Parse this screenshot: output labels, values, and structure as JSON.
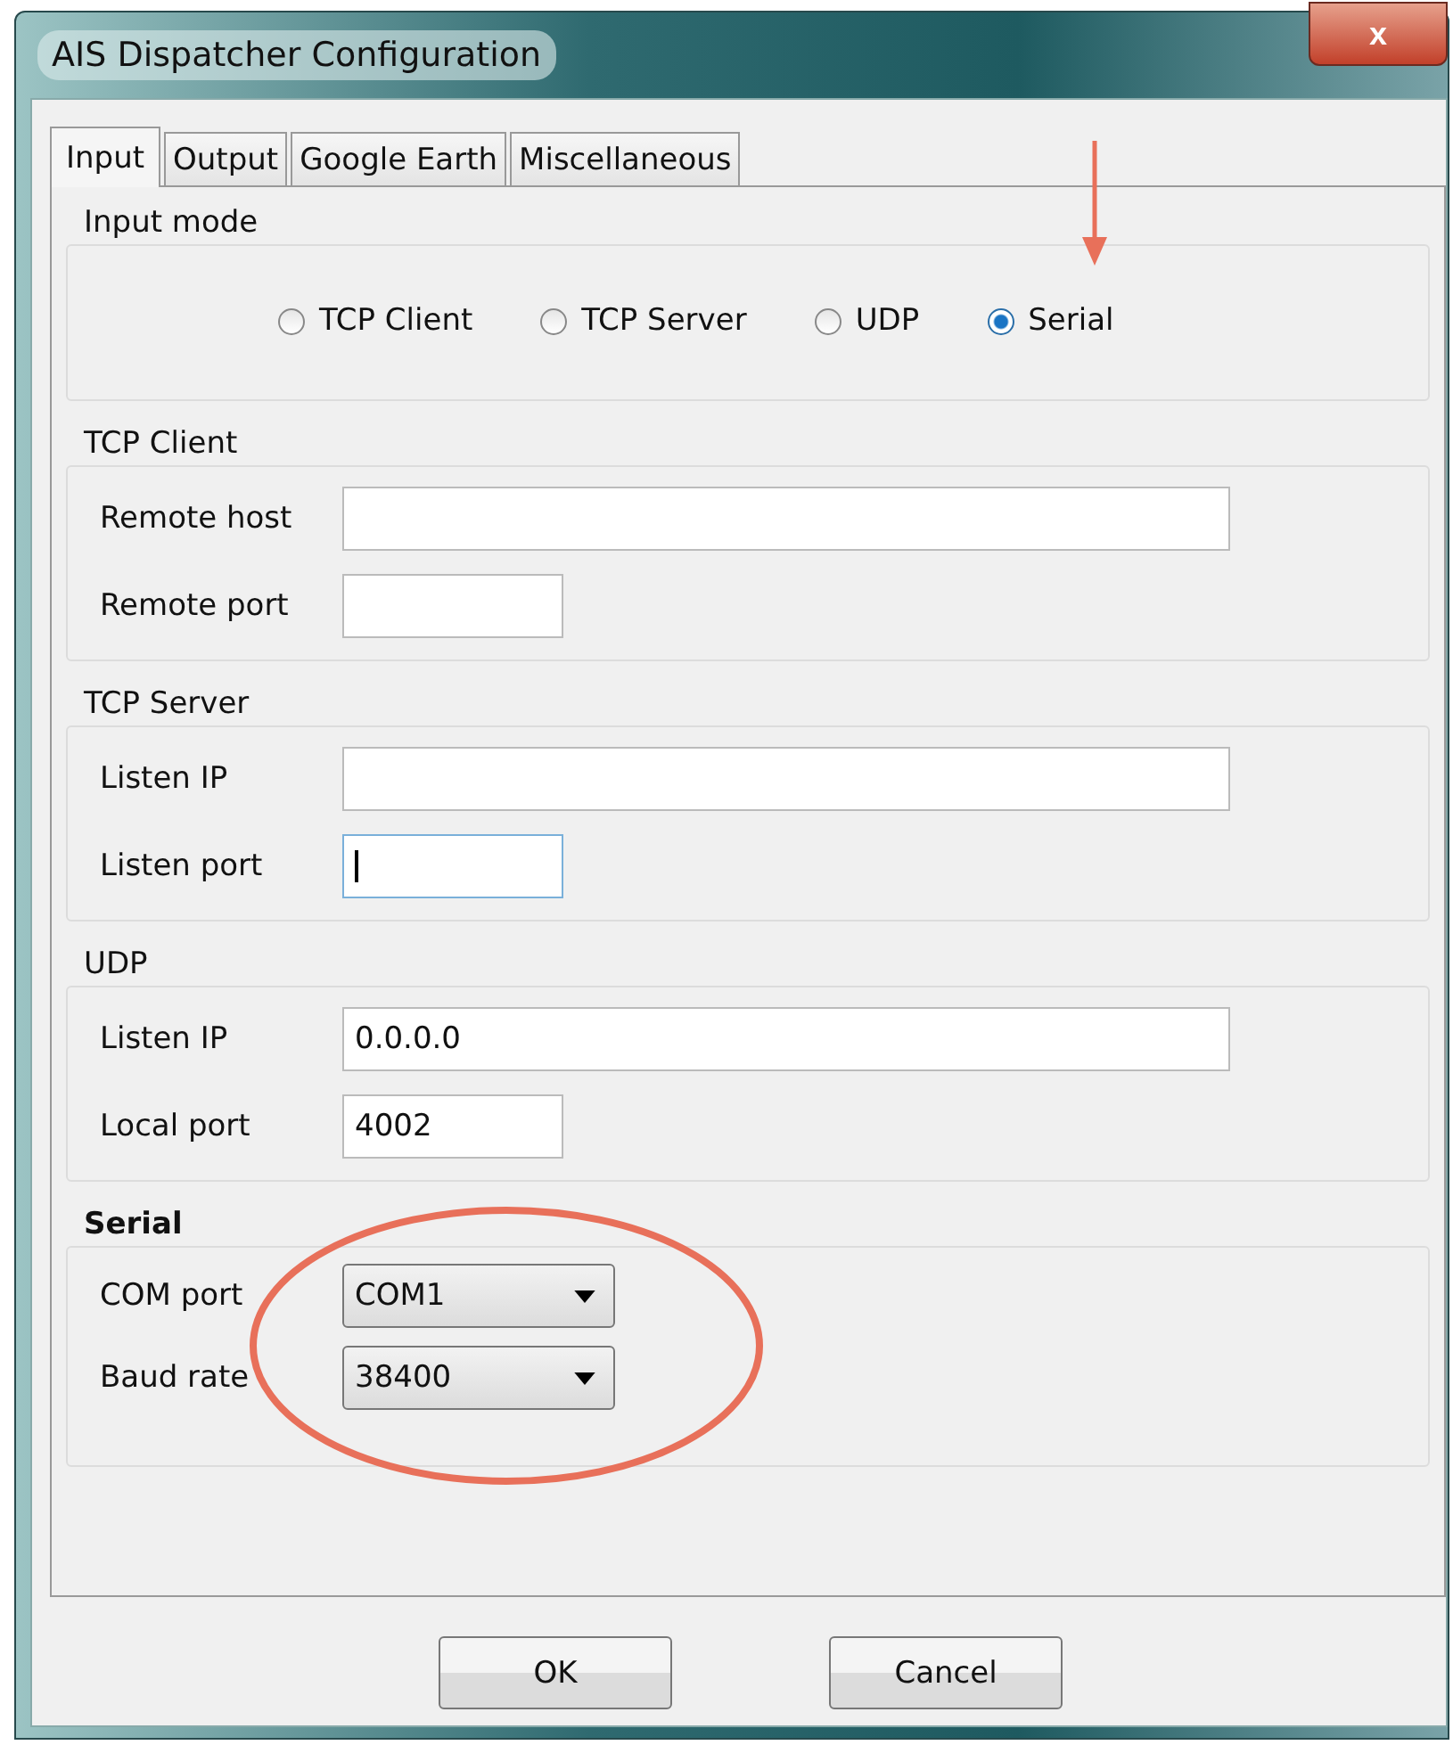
{
  "window": {
    "title": "AIS Dispatcher Configuration",
    "close": "x"
  },
  "tabs": [
    {
      "label": "Input",
      "selected": true
    },
    {
      "label": "Output",
      "selected": false
    },
    {
      "label": "Google Earth",
      "selected": false
    },
    {
      "label": "Miscellaneous",
      "selected": false
    }
  ],
  "groups": [
    {
      "title": "Input mode",
      "kind": "radios",
      "bold": false,
      "options": [
        {
          "label": "TCP Client",
          "selected": false
        },
        {
          "label": "TCP Server",
          "selected": false
        },
        {
          "label": "UDP",
          "selected": false
        },
        {
          "label": "Serial",
          "selected": true
        }
      ]
    },
    {
      "title": "TCP Client",
      "kind": "fields",
      "bold": false,
      "fields": [
        {
          "label": "Remote host",
          "kind": "wide",
          "focused": false
        },
        {
          "label": "Remote port",
          "kind": "narrow",
          "focused": false
        }
      ]
    },
    {
      "title": "TCP Server",
      "kind": "fields",
      "bold": false,
      "fields": [
        {
          "label": "Listen IP",
          "kind": "wide",
          "focused": false
        },
        {
          "label": "Listen port",
          "kind": "narrow",
          "focused": true
        }
      ]
    },
    {
      "title": "UDP",
      "kind": "fields",
      "bold": false,
      "fields": [
        {
          "label": "Listen IP",
          "kind": "wide",
          "focused": false,
          "value": "0.0.0.0"
        },
        {
          "label": "Local port",
          "kind": "narrow",
          "focused": false,
          "value": "4002"
        }
      ]
    },
    {
      "title": "Serial",
      "kind": "combos",
      "bold": true,
      "fields": [
        {
          "label": "COM port",
          "value": "COM1"
        },
        {
          "label": "Baud rate",
          "value": "38400"
        }
      ]
    }
  ],
  "buttons": [
    "OK",
    "Cancel"
  ]
}
